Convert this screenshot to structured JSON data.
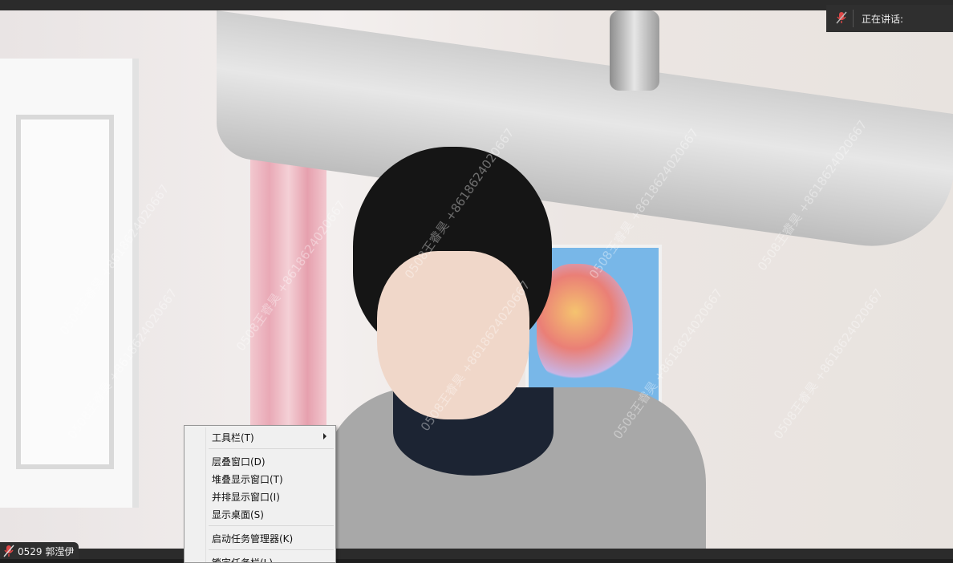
{
  "status": {
    "speaking_label": "正在讲话:"
  },
  "participant": {
    "name": "0529 郭滢伊"
  },
  "watermark_text": "0508王睿昊 +8618624020667",
  "context_menu": {
    "items": [
      {
        "label": "工具栏(T)",
        "submenu": true
      },
      {
        "label": "层叠窗口(D)"
      },
      {
        "label": "堆叠显示窗口(T)"
      },
      {
        "label": "并排显示窗口(I)"
      },
      {
        "label": "显示桌面(S)"
      },
      {
        "label": "启动任务管理器(K)"
      },
      {
        "label": "锁定任务栏(L)",
        "checked": true
      }
    ]
  },
  "icons": {
    "speaking_mic": "muted-mic-icon",
    "participant_mic": "muted-mic-icon"
  },
  "colors": {
    "bar_bg": "#2f2f2f",
    "menu_bg": "#f0f0f0",
    "mic_red": "#e04848"
  }
}
